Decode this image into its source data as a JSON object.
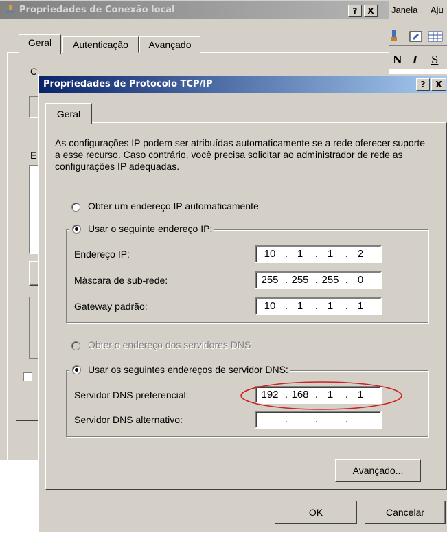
{
  "background_window": {
    "title": "Propriedades de Conexão local",
    "help_label": "?",
    "close_label": "X",
    "tabs": [
      {
        "label": "Geral"
      },
      {
        "label": "Autenticação"
      },
      {
        "label": "Avançado"
      }
    ],
    "partial_labels": {
      "conectar": "C",
      "estes": "E"
    }
  },
  "background_app": {
    "menu_items": [
      {
        "label": "Janela"
      },
      {
        "label": "Aju"
      }
    ],
    "format_buttons": [
      {
        "label": "N"
      },
      {
        "label": "I"
      },
      {
        "label": "S"
      }
    ]
  },
  "dialog": {
    "title": "Propriedades de Protocolo TCP/IP",
    "help_label": "?",
    "close_label": "X",
    "tabs": [
      {
        "label": "Geral"
      }
    ],
    "description": "As configurações IP podem ser atribuídas automaticamente se a rede oferecer suporte a esse recurso. Caso contrário, você precisa solicitar ao administrador de rede as configurações IP adequadas.",
    "ip_options": {
      "auto_label": "Obter um endereço IP automaticamente",
      "manual_label": "Usar o seguinte endereço IP:",
      "selected": "manual"
    },
    "ip_fields": [
      {
        "label": "Endereço IP:",
        "octets": [
          "10",
          "1",
          "1",
          "2"
        ]
      },
      {
        "label": "Máscara de sub-rede:",
        "octets": [
          "255",
          "255",
          "255",
          "0"
        ]
      },
      {
        "label": "Gateway padrão:",
        "octets": [
          "10",
          "1",
          "1",
          "1"
        ]
      }
    ],
    "dns_options": {
      "auto_label": "Obter o endereço dos servidores DNS",
      "manual_label": "Usar os seguintes endereços de servidor DNS:",
      "selected": "manual"
    },
    "dns_fields": [
      {
        "label": "Servidor DNS preferencial:",
        "octets": [
          "192",
          "168",
          "1",
          "1"
        ]
      },
      {
        "label": "Servidor DNS alternativo:",
        "octets": [
          "",
          "",
          "",
          ""
        ]
      }
    ],
    "octet_separator": ".",
    "advanced_button": "Avançado...",
    "ok_button": "OK",
    "cancel_button": "Cancelar",
    "annotation_color": "#cc2222"
  }
}
